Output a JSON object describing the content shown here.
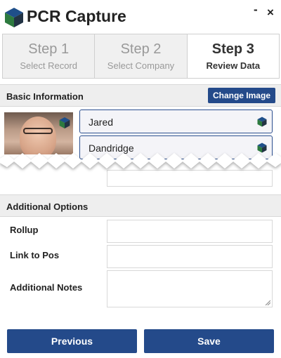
{
  "header": {
    "title": "PCR Capture",
    "minimize_label": "-",
    "close_label": "×",
    "logo_icon": "pcr-cube-logo-icon"
  },
  "steps": [
    {
      "num": "Step 1",
      "sub": "Select Record",
      "active": false
    },
    {
      "num": "Step 2",
      "sub": "Select Company",
      "active": false
    },
    {
      "num": "Step 3",
      "sub": "Review Data",
      "active": true
    }
  ],
  "basic_info": {
    "title": "Basic Information",
    "change_image_label": "Change Image",
    "first_name": "Jared",
    "last_name": "Dandridge"
  },
  "additional_options": {
    "title": "Additional Options",
    "rollup_label": "Rollup",
    "rollup_value": "",
    "link_label": "Link to Pos",
    "link_value": "",
    "notes_label": "Additional Notes",
    "notes_value": ""
  },
  "buttons": {
    "previous": "Previous",
    "save": "Save"
  },
  "colors": {
    "accent": "#244a8a",
    "section_bg": "#eeeeee",
    "field_border": "#2a4e8e"
  }
}
